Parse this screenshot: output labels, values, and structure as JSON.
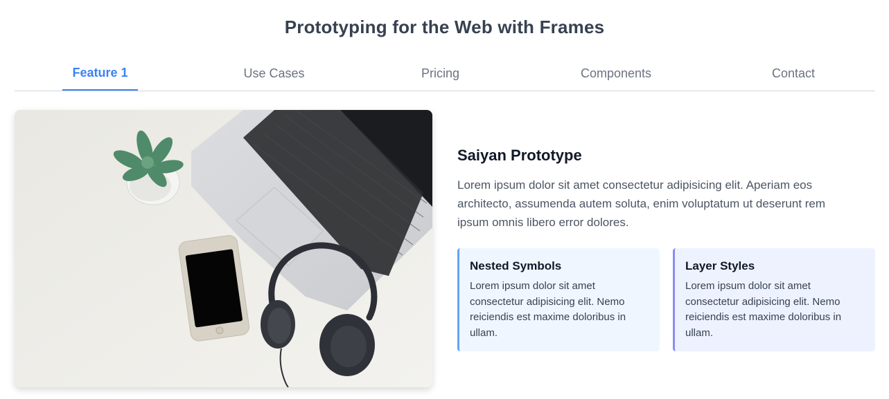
{
  "page": {
    "title": "Prototyping for the Web with Frames"
  },
  "tabs": [
    {
      "label": "Feature 1",
      "active": true
    },
    {
      "label": "Use Cases",
      "active": false
    },
    {
      "label": "Pricing",
      "active": false
    },
    {
      "label": "Components",
      "active": false
    },
    {
      "label": "Contact",
      "active": false
    }
  ],
  "hero_image": {
    "icon": "desk-photo-laptop-phone-headphones-plant"
  },
  "content": {
    "title": "Saiyan Prototype",
    "text": "Lorem ipsum dolor sit amet consectetur adipisicing elit. Aperiam eos architecto, assumenda autem soluta, enim voluptatum ut deserunt rem ipsum omnis libero error dolores.",
    "cards": [
      {
        "title": "Nested Symbols",
        "text": "Lorem ipsum dolor sit amet consectetur adipisicing elit. Nemo reiciendis est maxime doloribus in ullam."
      },
      {
        "title": "Layer Styles",
        "text": "Lorem ipsum dolor sit amet consectetur adipisicing elit. Nemo reiciendis est maxime doloribus in ullam."
      }
    ]
  },
  "colors": {
    "accent": "#3b82f6",
    "card1_border": "#60a5fa",
    "card2_border": "#8b8cf1",
    "card1_bg": "#eff6ff",
    "card2_bg": "#eef2ff"
  }
}
